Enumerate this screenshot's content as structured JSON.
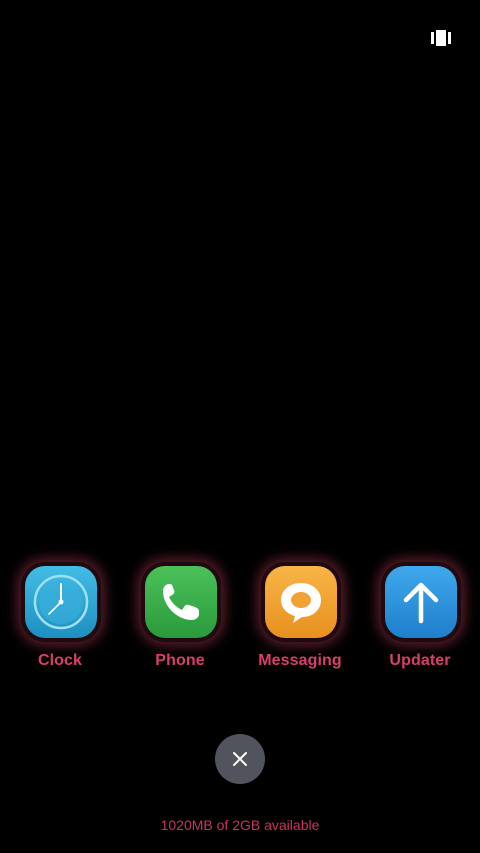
{
  "apps": [
    {
      "label": "Clock",
      "icon": "clock-icon",
      "color": "#2fa6d4"
    },
    {
      "label": "Phone",
      "icon": "phone-icon",
      "color": "#3db04c"
    },
    {
      "label": "Messaging",
      "icon": "message-bubble-icon",
      "color": "#f2a235"
    },
    {
      "label": "Updater",
      "icon": "arrow-up-icon",
      "color": "#2b92dc"
    }
  ],
  "close_icon": "close-icon",
  "memory_status": "1020MB of 2GB available",
  "colors": {
    "background": "#000000",
    "label": "#d8406a",
    "memory_text": "#c8345a",
    "close_button": "#51545c"
  }
}
